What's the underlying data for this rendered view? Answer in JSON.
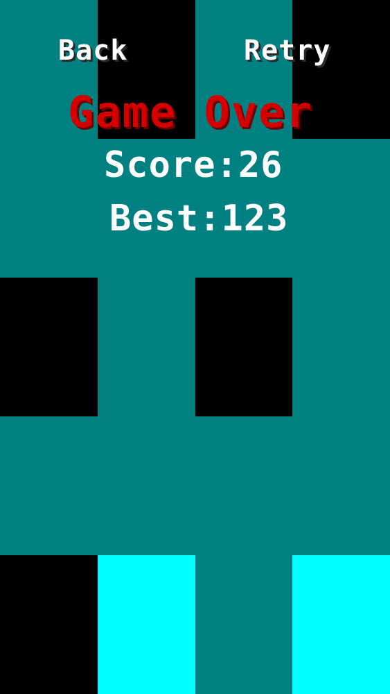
{
  "header": {
    "back_label": "Back",
    "retry_label": "Retry"
  },
  "result": {
    "title": "Game Over",
    "score_text": "Score:26",
    "best_text": "Best:123"
  },
  "colors": {
    "background": "#008080",
    "black_tile": "#000000",
    "tapped_tile": "#00FFFF",
    "title_red": "#D40000",
    "text_white": "#FFFFFF"
  },
  "board": {
    "columns": 4,
    "rows": [
      [
        "bg",
        "black",
        "bg",
        "black"
      ],
      [
        "bg",
        "bg",
        "bg",
        "bg"
      ],
      [
        "black",
        "bg",
        "black",
        "bg"
      ],
      [
        "bg",
        "bg",
        "bg",
        "bg"
      ],
      [
        "black",
        "tapped",
        "bg",
        "tapped"
      ]
    ]
  }
}
